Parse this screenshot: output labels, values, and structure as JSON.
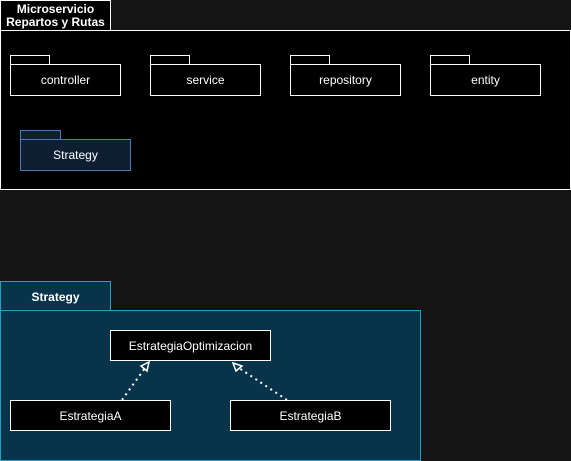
{
  "microservice": {
    "title_line1": "Microservicio",
    "title_line2": "Repartos y Rutas"
  },
  "packages": {
    "controller": "controller",
    "service": "service",
    "repository": "repository",
    "entity": "entity",
    "strategy": "Strategy"
  },
  "strategy_frame": {
    "title": "Strategy",
    "interface": "EstrategiaOptimizacion",
    "impl_a": "EstrategiaA",
    "impl_b": "EstrategiaB"
  },
  "colors": {
    "background": "#141414",
    "frame_border": "#ffffff",
    "strategy_fill": "#07344a",
    "strategy_border": "#23a0c4",
    "strategy_package_border": "#4a7bb5"
  }
}
